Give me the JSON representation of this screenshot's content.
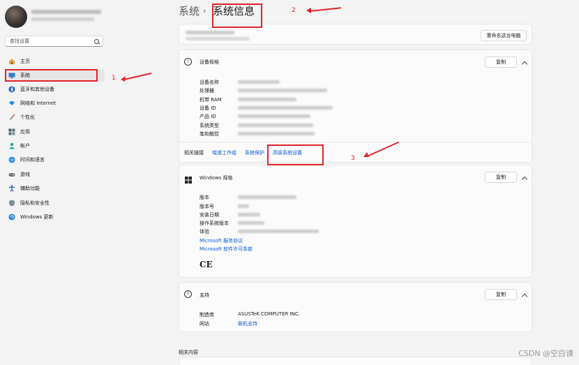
{
  "sidebar": {
    "search_placeholder": "查找设置",
    "items": [
      {
        "label": "主页",
        "icon": "home-icon"
      },
      {
        "label": "系统",
        "icon": "monitor-icon"
      },
      {
        "label": "蓝牙和其他设备",
        "icon": "bluetooth-icon"
      },
      {
        "label": "网络和 Internet",
        "icon": "wifi-icon"
      },
      {
        "label": "个性化",
        "icon": "brush-icon"
      },
      {
        "label": "应用",
        "icon": "apps-icon"
      },
      {
        "label": "帐户",
        "icon": "account-icon"
      },
      {
        "label": "时间和语言",
        "icon": "globe-clock-icon"
      },
      {
        "label": "游戏",
        "icon": "gamepad-icon"
      },
      {
        "label": "辅助功能",
        "icon": "accessibility-icon"
      },
      {
        "label": "隐私和安全性",
        "icon": "shield-icon"
      },
      {
        "label": "Windows 更新",
        "icon": "update-icon"
      }
    ]
  },
  "breadcrumb": {
    "parent": "系统",
    "separator": "›",
    "current": "系统信息"
  },
  "device_card": {
    "rename_button": "重命名这台电脑"
  },
  "device_specs": {
    "title": "设备规格",
    "copy_button": "复制",
    "labels": [
      "设备名称",
      "处理器",
      "机带 RAM",
      "设备 ID",
      "产品 ID",
      "系统类型",
      "笔和触控"
    ],
    "related_label": "相关链接",
    "related_links": [
      "域或工作组",
      "系统保护",
      "高级系统设置"
    ]
  },
  "windows_specs": {
    "title": "Windows 规格",
    "copy_button": "复制",
    "labels": [
      "版本",
      "版本号",
      "安装日期",
      "操作系统版本",
      "体验"
    ],
    "links": [
      "Microsoft 服务协议",
      "Microsoft 软件许可条款"
    ],
    "ce_mark": "CE"
  },
  "support": {
    "title": "支持",
    "copy_button": "复制",
    "rows": [
      {
        "label": "制造商",
        "value": "ASUSTeK COMPUTER INC."
      },
      {
        "label": "网站",
        "value": "联机支持"
      }
    ]
  },
  "related_content_title": "相关内容",
  "annotations": {
    "n1": "1",
    "n2": "2",
    "n3": "3",
    "color": "#e0242a"
  },
  "watermark": "CSDN @空白谏",
  "colors": {
    "accent": "#0a5ad4",
    "background": "#f3f3f3",
    "card": "#fbfbfb"
  }
}
